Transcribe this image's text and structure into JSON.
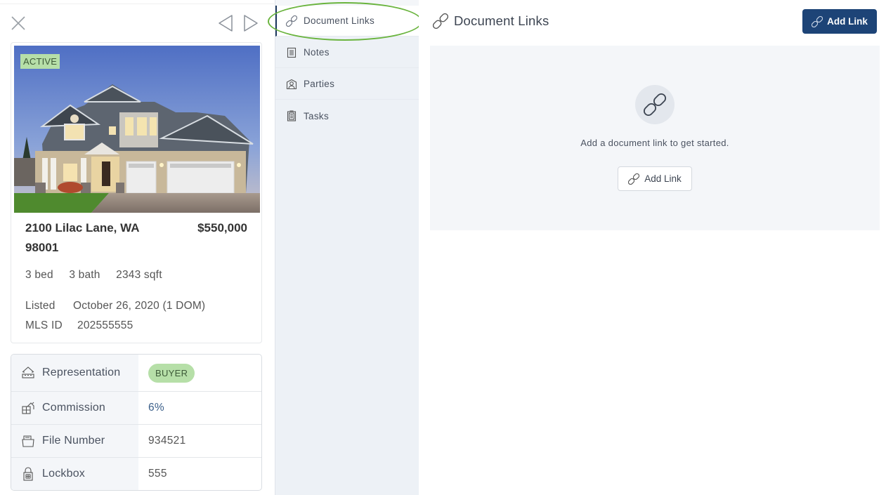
{
  "listing": {
    "status_badge": "ACTIVE",
    "address": "2100 Lilac Lane, WA 98001",
    "price": "$550,000",
    "beds": "3 bed",
    "baths": "3 bath",
    "sqft": "2343 sqft",
    "listed_label": "Listed",
    "listed_value": "October 26, 2020 (1 DOM)",
    "mls_label": "MLS ID",
    "mls_value": "202555555"
  },
  "details": [
    {
      "label": "Representation",
      "value": "BUYER",
      "icon": "house-sign-icon"
    },
    {
      "label": "Commission",
      "value": "6%",
      "icon": "building-icon"
    },
    {
      "label": "File Number",
      "value": "934521",
      "icon": "folder-icon"
    },
    {
      "label": "Lockbox",
      "value": "555",
      "icon": "lockbox-icon"
    }
  ],
  "nav": {
    "items": [
      {
        "label": "Document Links",
        "icon": "link-icon",
        "active": true
      },
      {
        "label": "Notes",
        "icon": "notes-icon"
      },
      {
        "label": "Parties",
        "icon": "person-icon"
      },
      {
        "label": "Tasks",
        "icon": "clipboard-icon"
      }
    ]
  },
  "main": {
    "title": "Document Links",
    "add_link_label": "Add Link",
    "empty_message": "Add a document link to get started.",
    "empty_add_link_label": "Add Link"
  },
  "colors": {
    "primary": "#1d4477",
    "badge_green": "#b6dfa8",
    "highlight": "#6ab43e"
  }
}
